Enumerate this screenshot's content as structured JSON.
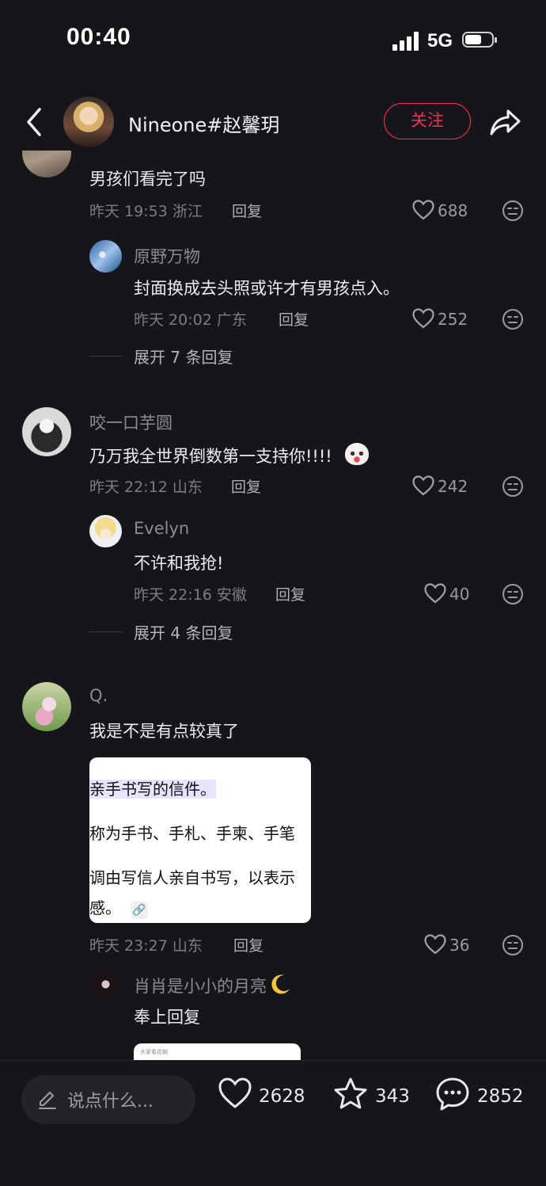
{
  "status_bar": {
    "time": "00:40",
    "network": "5G"
  },
  "header": {
    "username": "Nineone#赵馨玥",
    "follow_label": "关注"
  },
  "comments": [
    {
      "text": "男孩们看完了吗",
      "time": "昨天 19:53 浙江",
      "reply_label": "回复",
      "likes": "688",
      "replies": [
        {
          "name": "原野万物",
          "text": "封面换成去头照或许才有男孩点入。",
          "time": "昨天 20:02 广东",
          "reply_label": "回复",
          "likes": "252"
        }
      ],
      "expand_label": "展开 7 条回复"
    },
    {
      "name": "咬一口芋圆",
      "text": "乃万我全世界倒数第一支持你!!!!",
      "time": "昨天 22:12 山东",
      "reply_label": "回复",
      "likes": "242",
      "replies": [
        {
          "name": "Evelyn",
          "text": "不许和我抢!",
          "time": "昨天 22:16 安徽",
          "reply_label": "回复",
          "likes": "40"
        }
      ],
      "expand_label": "展开 4 条回复"
    },
    {
      "name": "Q.",
      "text": "我是不是有点较真了",
      "image_lines": [
        "亲手书写的信件。",
        "称为手书、手札、手柬、手笔",
        "调由写信人亲自书写，以表示",
        "感。"
      ],
      "time": "昨天 23:27 山东",
      "reply_label": "回复",
      "likes": "36",
      "replies": [
        {
          "name": "肖肖是小小的月亮",
          "text": "奉上回复",
          "image_caption": "大家看花朝"
        }
      ]
    }
  ],
  "bottom_bar": {
    "input_placeholder": "说点什么...",
    "likes": "2628",
    "favorites": "343",
    "comments": "2852"
  },
  "colors": {
    "background": "#16161a",
    "accent": "#ff2d55"
  }
}
